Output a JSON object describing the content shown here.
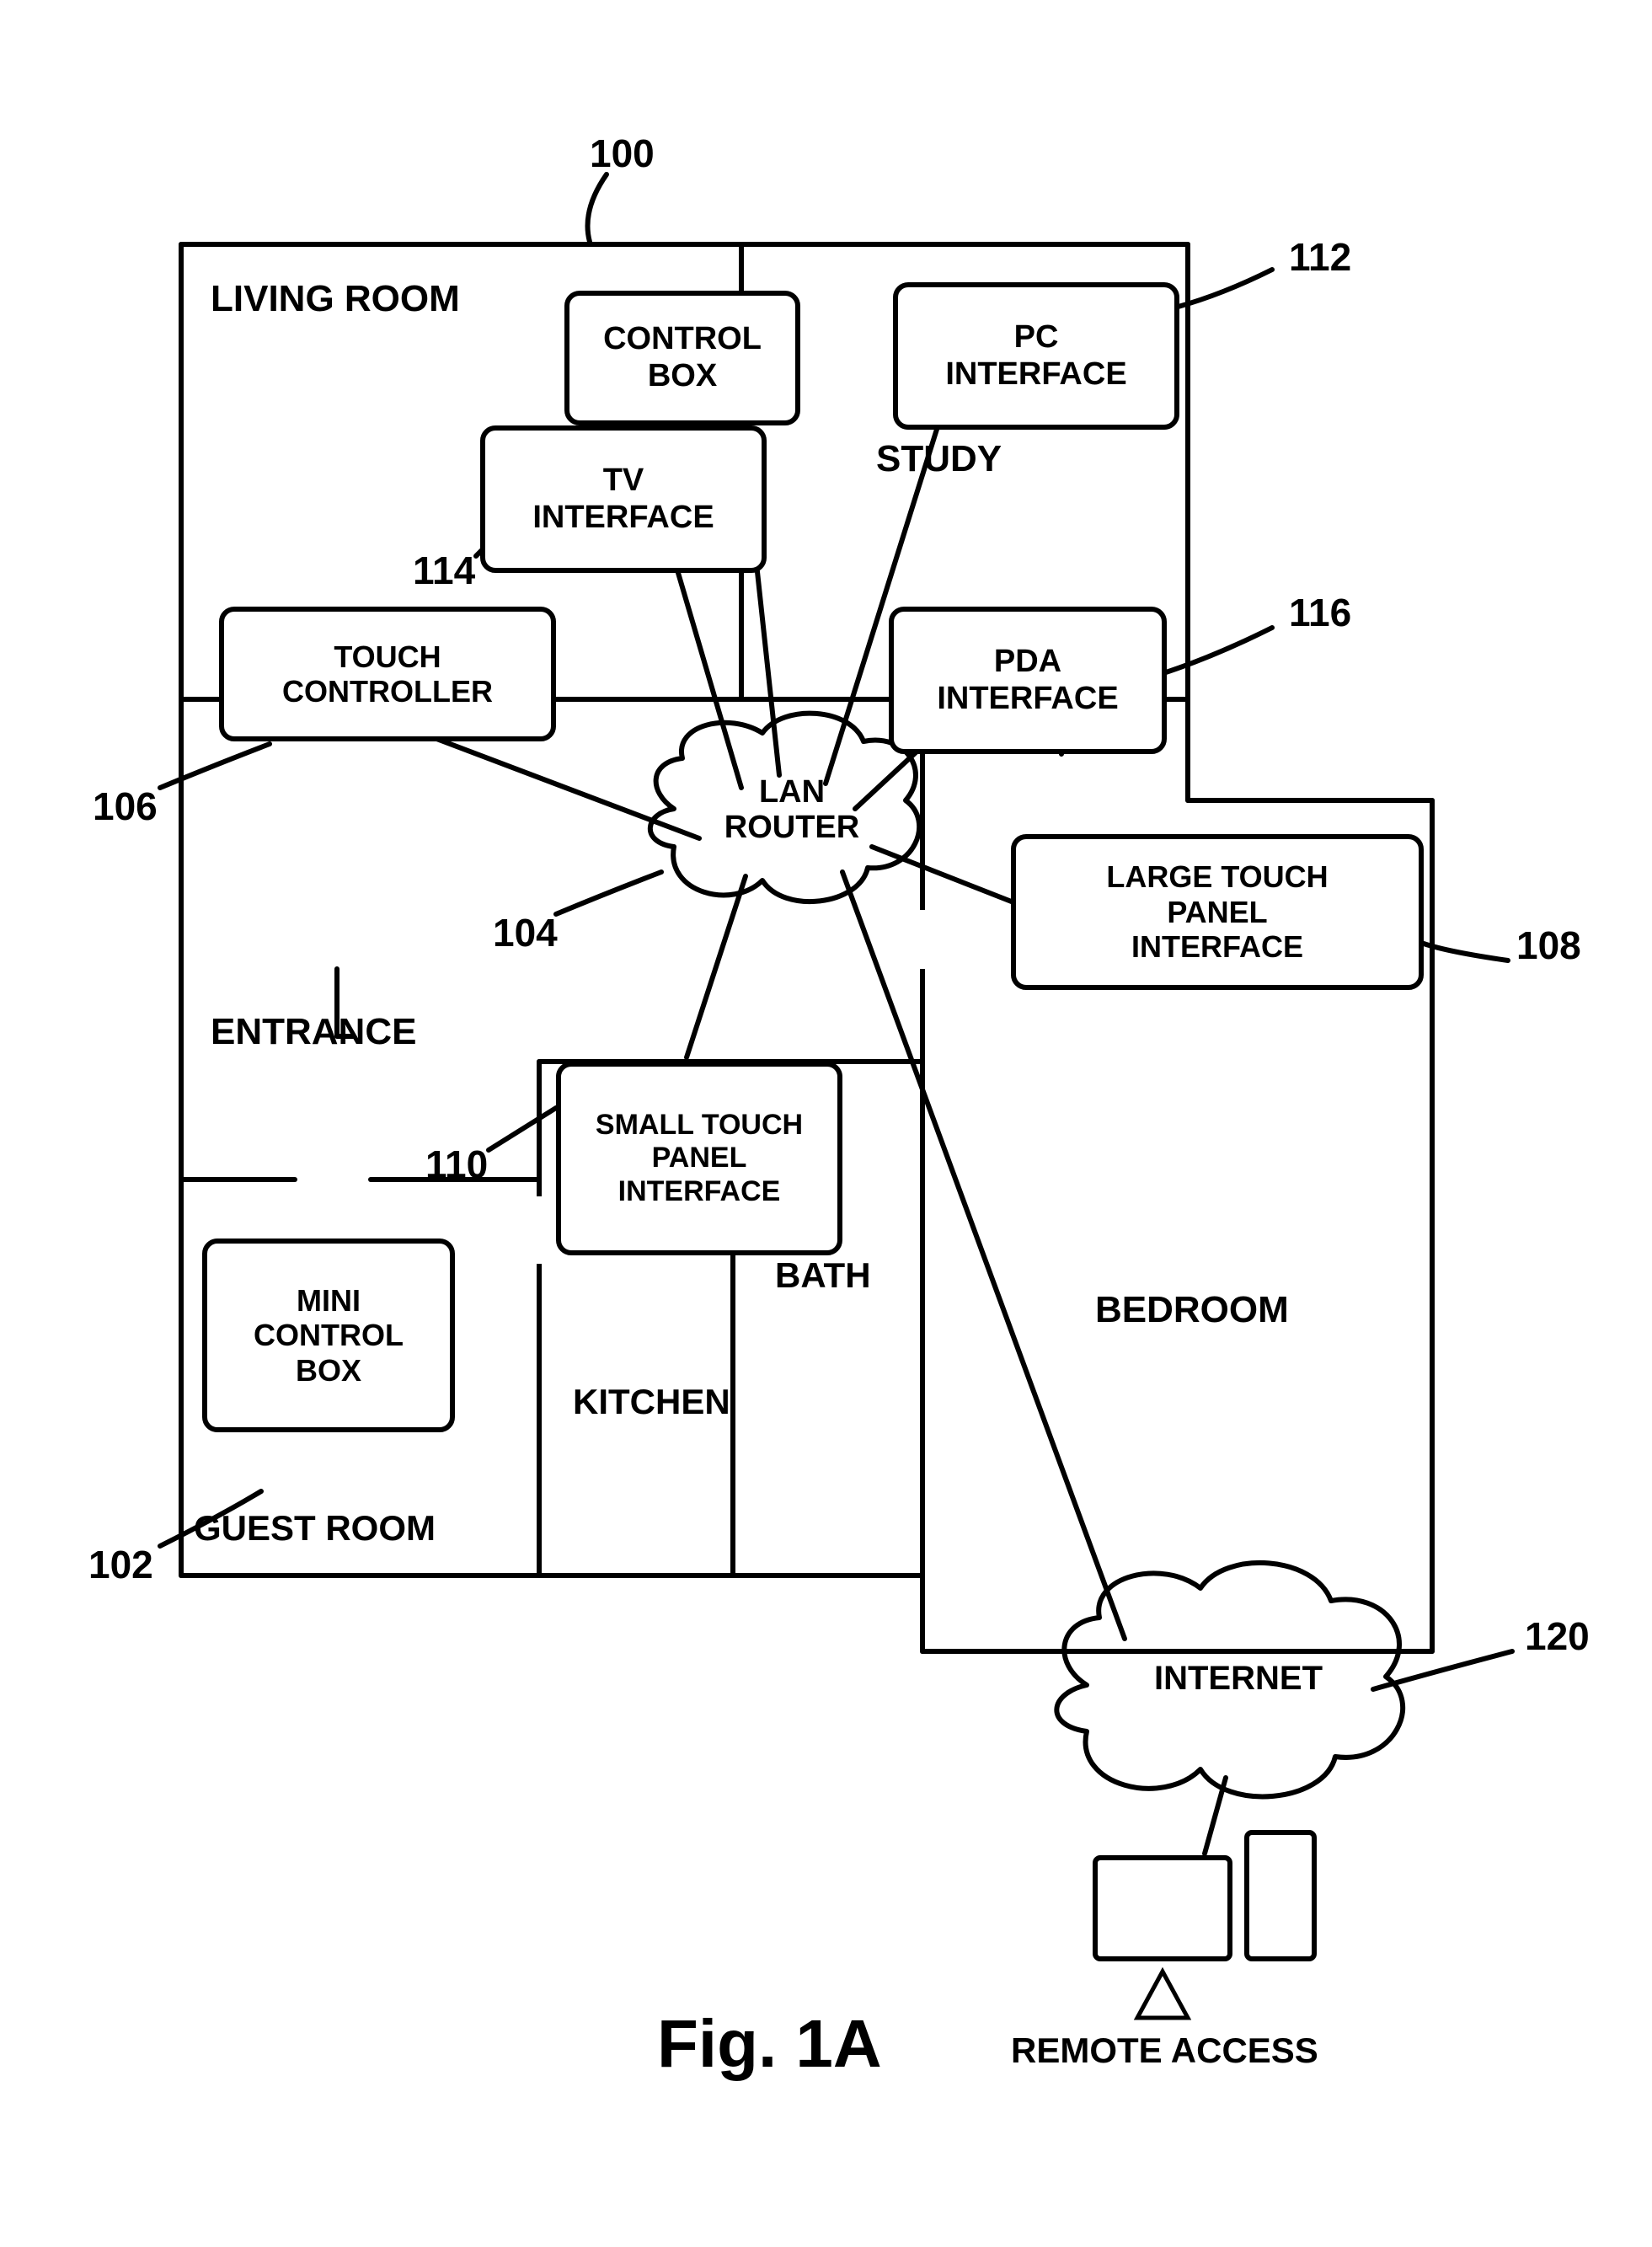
{
  "figure_label": "Fig. 1A",
  "refs": {
    "house": "100",
    "mini_control_box": "102",
    "lan_router": "104",
    "touch_controller": "106",
    "large_touch_panel": "108",
    "small_touch_panel": "110",
    "pc_interface": "112",
    "tv_interface": "114",
    "pda_interface": "116",
    "internet": "120"
  },
  "rooms": {
    "living_room": "LIVING ROOM",
    "study": "STUDY",
    "entrance": "ENTRANCE",
    "guest_room": "GUEST ROOM",
    "kitchen": "KITCHEN",
    "bath": "BATH",
    "bedroom": "BEDROOM"
  },
  "nodes": {
    "control_box": "CONTROL\nBOX",
    "pc_interface": "PC\nINTERFACE",
    "tv_interface": "TV\nINTERFACE",
    "touch_controller": "TOUCH\nCONTROLLER",
    "pda_interface": "PDA\nINTERFACE",
    "lan_router": "LAN\nROUTER",
    "small_touch_panel": "SMALL TOUCH\nPANEL\nINTERFACE",
    "mini_control_box": "MINI\nCONTROL\nBOX",
    "large_touch_panel": "LARGE TOUCH\nPANEL\nINTERFACE",
    "internet": "INTERNET",
    "remote_access": "REMOTE ACCESS"
  }
}
